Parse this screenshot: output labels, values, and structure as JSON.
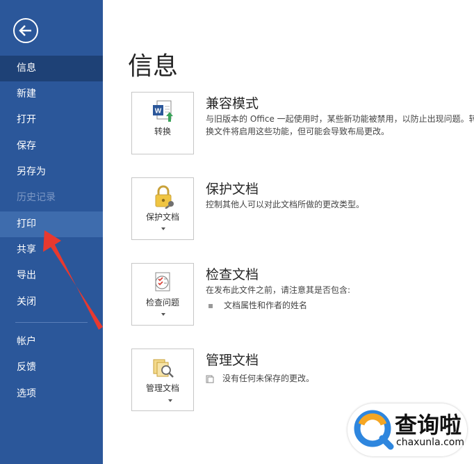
{
  "sidebar": {
    "items": [
      {
        "label": "信息"
      },
      {
        "label": "新建"
      },
      {
        "label": "打开"
      },
      {
        "label": "保存"
      },
      {
        "label": "另存为"
      },
      {
        "label": "历史记录"
      },
      {
        "label": "打印"
      },
      {
        "label": "共享"
      },
      {
        "label": "导出"
      },
      {
        "label": "关闭"
      },
      {
        "label": "帐户"
      },
      {
        "label": "反馈"
      },
      {
        "label": "选项"
      }
    ]
  },
  "main": {
    "title": "信息",
    "sections": [
      {
        "tile_label": "转换",
        "title": "兼容模式",
        "description": "与旧版本的 Office 一起使用时，某些新功能被禁用，以防止出现问题。转换文件将启用这些功能，但可能会导致布局更改。"
      },
      {
        "tile_label": "保护文档",
        "title": "保护文档",
        "description": "控制其他人可以对此文档所做的更改类型。"
      },
      {
        "tile_label": "检查问题",
        "title": "检查文档",
        "description": "在发布此文件之前，请注意其是否包含:",
        "bullet": "文档属性和作者的姓名"
      },
      {
        "tile_label": "管理文档",
        "title": "管理文档",
        "status": "没有任何未保存的更改。"
      }
    ]
  },
  "watermark": {
    "cn": "查询啦",
    "en": "chaxunla.com"
  },
  "colors": {
    "sidebar_bg": "#2b579a",
    "sidebar_active": "#1e4176",
    "annotation_arrow": "#e8392f"
  }
}
